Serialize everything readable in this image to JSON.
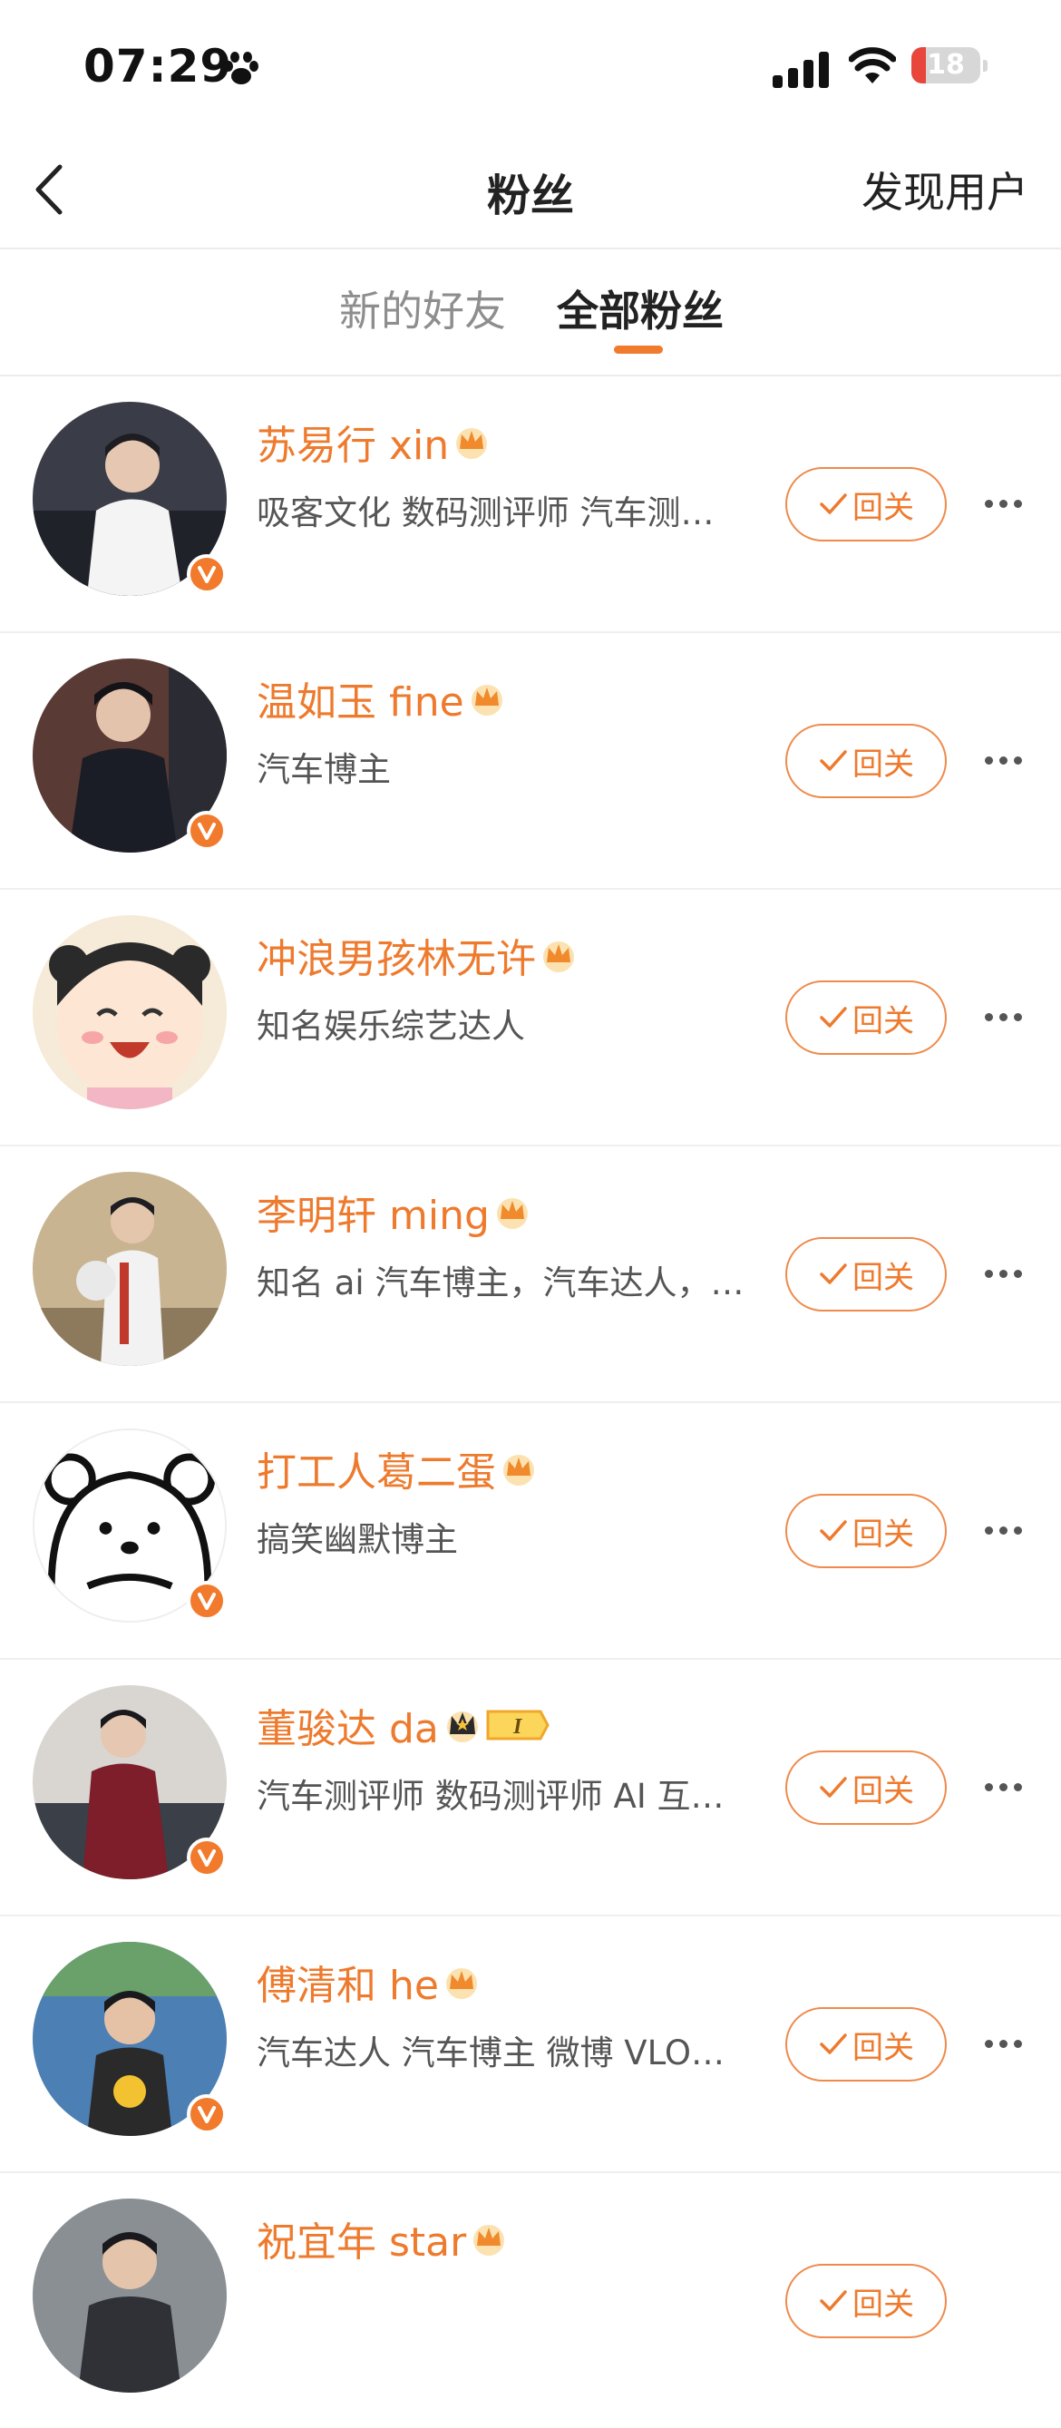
{
  "status_bar": {
    "time": "07:29",
    "battery": "18"
  },
  "nav": {
    "title": "粉丝",
    "right_action": "发现用户"
  },
  "tabs": [
    {
      "label": "新的好友",
      "active": false
    },
    {
      "label": "全部粉丝",
      "active": true
    }
  ],
  "follow_label": "回关",
  "fans": [
    {
      "name": "苏易行 xin",
      "desc": "吸客文化 数码测评师 汽车测评博主",
      "verified": true
    },
    {
      "name": "温如玉 fine",
      "desc": "汽车博主",
      "verified": true
    },
    {
      "name": "冲浪男孩林无许",
      "desc": "知名娱乐综艺达人",
      "verified": false
    },
    {
      "name": "李明轩 ming",
      "desc": "知名 ai 汽车博主，汽车达人，数码博主",
      "verified": false
    },
    {
      "name": "打工人葛二蛋",
      "desc": "搞笑幽默博主",
      "verified": true
    },
    {
      "name": "董骏达 da",
      "desc": "汽车测评师 数码测评师 AI 互联网博主",
      "verified": true
    },
    {
      "name": "傅清和 he",
      "desc": "汽车达人 汽车博主 微博 VLOG博主",
      "verified": true
    },
    {
      "name": "祝宜年 star",
      "desc": "",
      "verified": false
    }
  ],
  "colors": {
    "accent": "#ee7a2d",
    "badge": "#f17a2c"
  }
}
